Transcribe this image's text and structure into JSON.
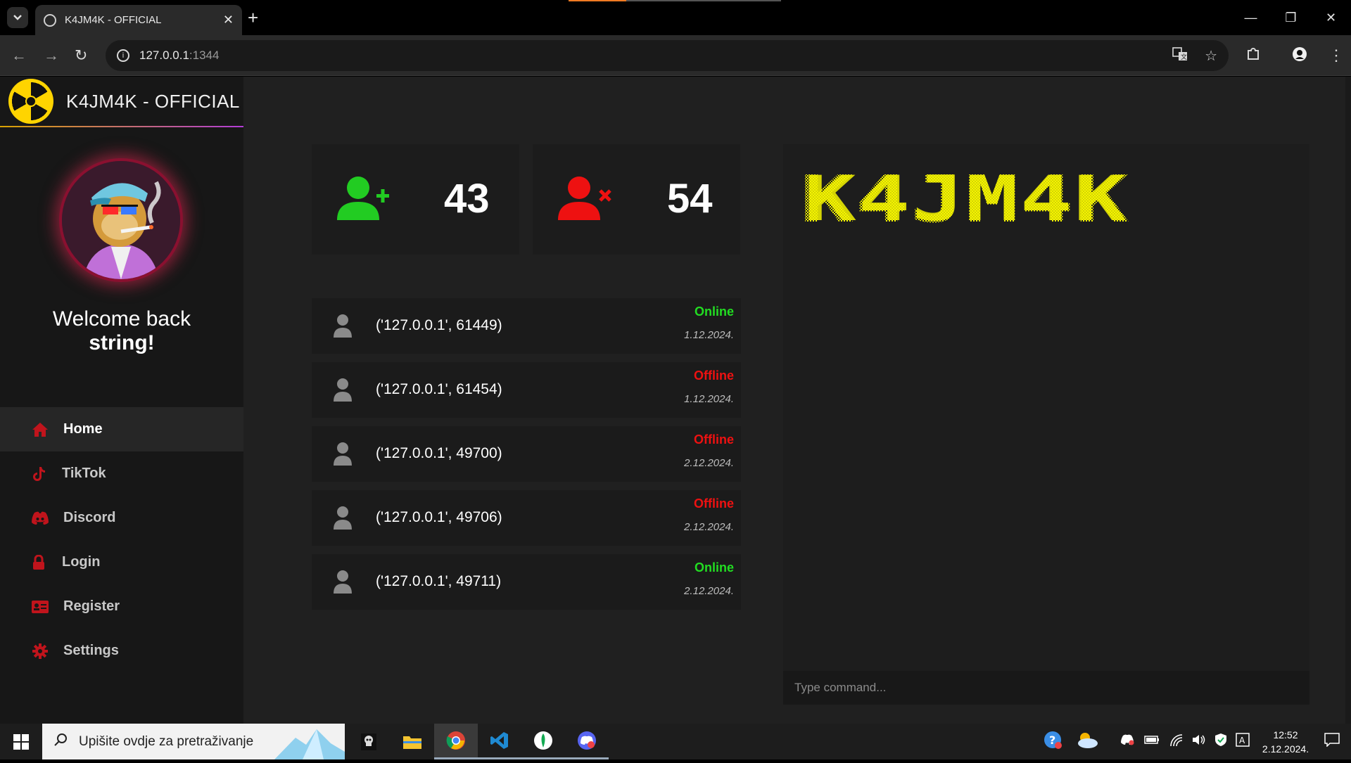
{
  "browser": {
    "tab_title": "K4JM4K - OFFICIAL",
    "url_host": "127.0.0.1",
    "url_port": ":1344"
  },
  "sidebar": {
    "brand": "K4JM4K - OFFICIAL",
    "welcome_line1": "Welcome back",
    "username": "string",
    "welcome_suffix": "!",
    "nav": [
      {
        "label": "Home",
        "icon": "home-icon",
        "active": true
      },
      {
        "label": "TikTok",
        "icon": "tiktok-icon"
      },
      {
        "label": "Discord",
        "icon": "discord-icon"
      },
      {
        "label": "Login",
        "icon": "lock-icon"
      },
      {
        "label": "Register",
        "icon": "id-card-icon"
      },
      {
        "label": "Settings",
        "icon": "gear-icon"
      }
    ]
  },
  "stats": {
    "online_count": "43",
    "offline_count": "54"
  },
  "clients": [
    {
      "addr": "('127.0.0.1', 61449)",
      "status": "Online",
      "date": "1.12.2024."
    },
    {
      "addr": "('127.0.0.1', 61454)",
      "status": "Offline",
      "date": "1.12.2024."
    },
    {
      "addr": "('127.0.0.1', 49700)",
      "status": "Offline",
      "date": "2.12.2024."
    },
    {
      "addr": "('127.0.0.1', 49706)",
      "status": "Offline",
      "date": "2.12.2024."
    },
    {
      "addr": "('127.0.0.1', 49711)",
      "status": "Online",
      "date": "2.12.2024."
    }
  ],
  "console": {
    "logo": "K4JM4K",
    "placeholder": "Type command..."
  },
  "taskbar": {
    "search_placeholder": "Upišite ovdje za pretraživanje",
    "time": "12:52",
    "date": "2.12.2024."
  },
  "colors": {
    "online": "#22dd22",
    "offline": "#ee1111",
    "accent_red": "#c0141c",
    "logo_yellow": "#f4f400"
  }
}
